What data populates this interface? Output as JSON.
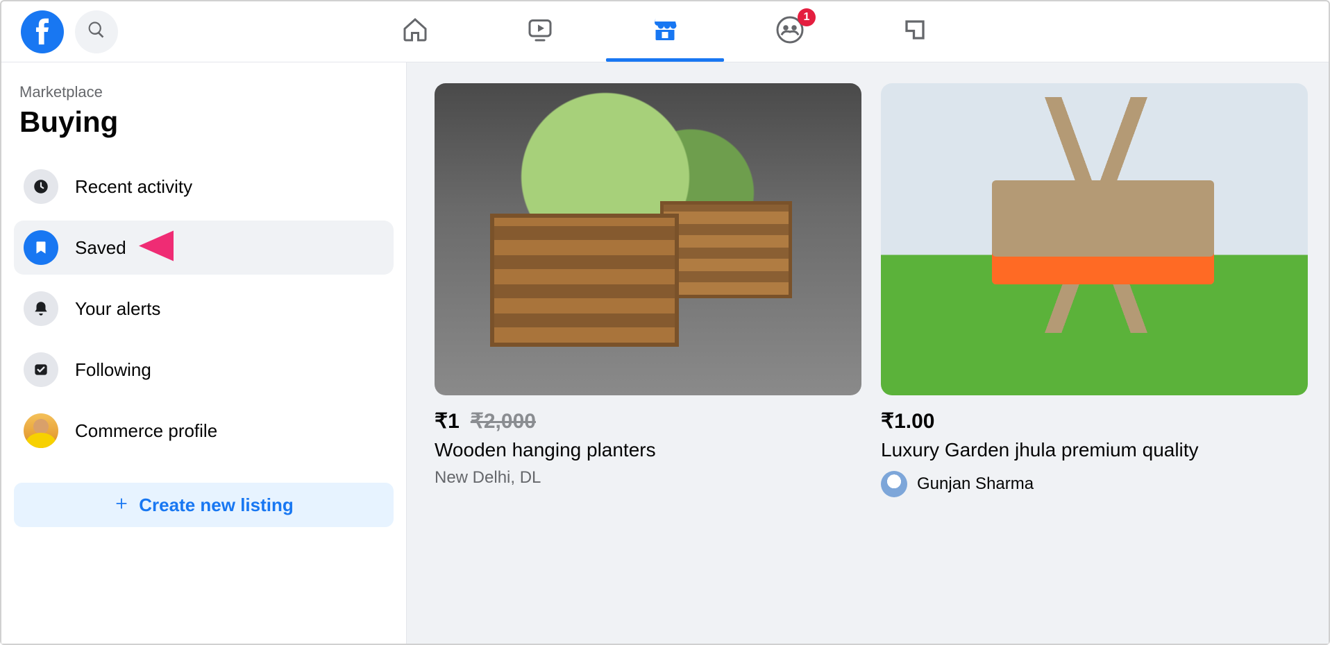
{
  "nav": {
    "groups_badge": "1"
  },
  "sidebar": {
    "breadcrumb": "Marketplace",
    "title": "Buying",
    "items": [
      {
        "label": "Recent activity"
      },
      {
        "label": "Saved"
      },
      {
        "label": "Your alerts"
      },
      {
        "label": "Following"
      },
      {
        "label": "Commerce profile"
      }
    ],
    "create_label": "Create new listing"
  },
  "listings": [
    {
      "price": "₹1",
      "old_price": "₹2,000",
      "title": "Wooden hanging planters",
      "location": "New Delhi, DL"
    },
    {
      "price": "₹1.00",
      "title": "Luxury Garden jhula premium quality",
      "seller": "Gunjan Sharma"
    }
  ]
}
